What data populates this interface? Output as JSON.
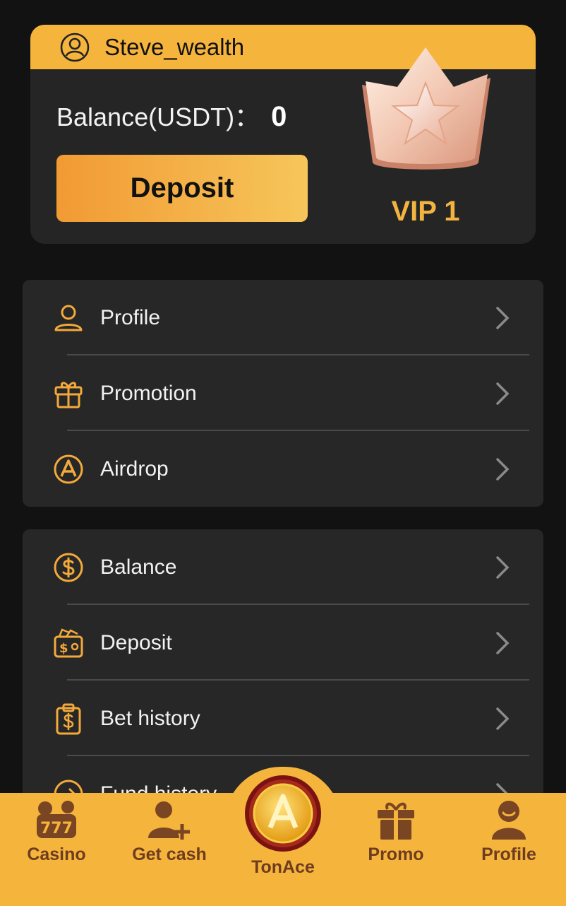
{
  "account": {
    "username": "Steve_wealth",
    "balance_label": "Balance(USDT)：",
    "balance_value": "0",
    "deposit_button": "Deposit",
    "vip_level": "VIP 1"
  },
  "menu_group_1": [
    {
      "label": "Profile",
      "icon": "user-icon"
    },
    {
      "label": "Promotion",
      "icon": "gift-icon"
    },
    {
      "label": "Airdrop",
      "icon": "airdrop-coin-icon"
    }
  ],
  "menu_group_2": [
    {
      "label": "Balance",
      "icon": "dollar-coin-icon"
    },
    {
      "label": "Deposit",
      "icon": "wallet-icon"
    },
    {
      "label": "Bet history",
      "icon": "clipboard-dollar-icon"
    },
    {
      "label": "Fund history",
      "icon": "arrow-circle-icon"
    }
  ],
  "bottom_nav": {
    "items": [
      {
        "label": "Casino",
        "icon": "slot-777-icon"
      },
      {
        "label": "Get cash",
        "icon": "add-user-icon"
      },
      {
        "label": "TonAce",
        "icon": "tonace-coin-icon"
      },
      {
        "label": "Promo",
        "icon": "gift-box-icon"
      },
      {
        "label": "Profile",
        "icon": "profile-avatar-icon"
      }
    ]
  },
  "colors": {
    "background": "#121212",
    "card": "#252525",
    "accent": "#f5b43c",
    "deposit_gradient_start": "#f29a34",
    "deposit_gradient_end": "#f6c65a",
    "nav_text": "#6e3c1f"
  }
}
